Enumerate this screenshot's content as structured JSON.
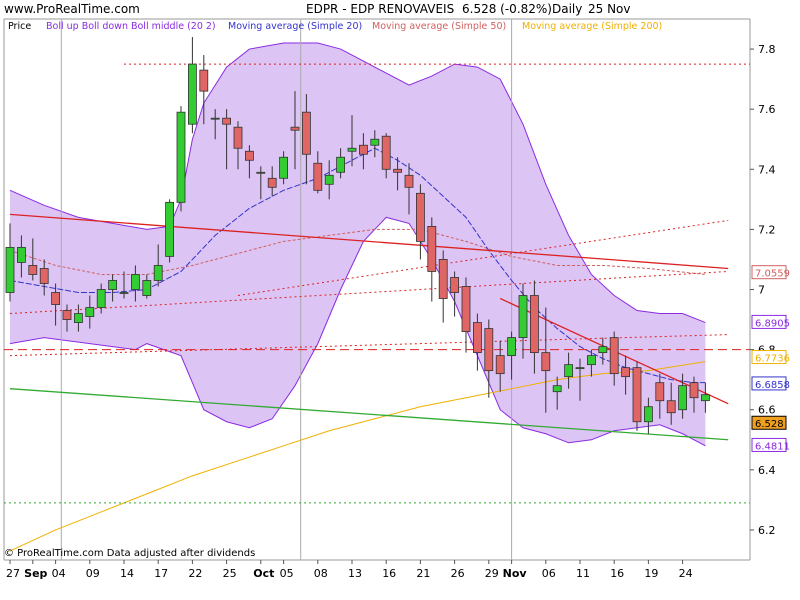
{
  "header": {
    "site": "www.ProRealTime.com",
    "title": "EDPR - EDP RENOVAVEIS",
    "quote": "6.528 (-0.82%)",
    "period": "Daily",
    "date": "25 Nov"
  },
  "footer": {
    "note": "© ProRealTime.com  Data adjusted after dividends"
  },
  "legend": [
    {
      "label": "Price",
      "color": "#000000"
    },
    {
      "label": "Boll up Boll down Boll middle (20 2)",
      "color": "#8a2be2"
    },
    {
      "label": "Moving average (Simple 20)",
      "color": "#3333cc"
    },
    {
      "label": "Moving average (Simple 50)",
      "color": "#d06060"
    },
    {
      "label": "Moving average (Simple 200)",
      "color": "#f0b000"
    }
  ],
  "colors": {
    "up": "#33cc33",
    "down": "#e06666",
    "band_fill": "#dcc4f4",
    "band_line": "#8a2be2",
    "ma20": "#3333cc",
    "ma50": "#d06060",
    "ma200": "#f0b000",
    "trend_red": "#dd2222",
    "trend_green": "#33aa33",
    "price_tag": "#f0a020"
  },
  "chart_data": {
    "type": "candlestick",
    "ylim": [
      6.1,
      7.9
    ],
    "y_ticks": [
      "7.8",
      "7.6",
      "7.4",
      "7.2",
      "7",
      "6.8",
      "6.6",
      "6.4",
      "6.2"
    ],
    "y_tick_values": [
      7.8,
      7.6,
      7.4,
      7.2,
      7.0,
      6.8,
      6.6,
      6.4,
      6.2
    ],
    "x_labels": [
      {
        "label": "27",
        "i": 0,
        "bold": false
      },
      {
        "label": "Sep",
        "i": 2,
        "bold": true
      },
      {
        "label": "04",
        "i": 4,
        "bold": false
      },
      {
        "label": "09",
        "i": 7,
        "bold": false
      },
      {
        "label": "14",
        "i": 10,
        "bold": false
      },
      {
        "label": "17",
        "i": 13,
        "bold": false
      },
      {
        "label": "22",
        "i": 16,
        "bold": false
      },
      {
        "label": "25",
        "i": 19,
        "bold": false
      },
      {
        "label": "Oct",
        "i": 22,
        "bold": true
      },
      {
        "label": "05",
        "i": 24,
        "bold": false
      },
      {
        "label": "08",
        "i": 27,
        "bold": false
      },
      {
        "label": "13",
        "i": 30,
        "bold": false
      },
      {
        "label": "16",
        "i": 33,
        "bold": false
      },
      {
        "label": "21",
        "i": 36,
        "bold": false
      },
      {
        "label": "26",
        "i": 39,
        "bold": false
      },
      {
        "label": "29",
        "i": 42,
        "bold": false
      },
      {
        "label": "Nov",
        "i": 44,
        "bold": true
      },
      {
        "label": "06",
        "i": 47,
        "bold": false
      },
      {
        "label": "11",
        "i": 50,
        "bold": false
      },
      {
        "label": "16",
        "i": 53,
        "bold": false
      },
      {
        "label": "19",
        "i": 56,
        "bold": false
      },
      {
        "label": "24",
        "i": 59,
        "bold": false
      }
    ],
    "month_separators": [
      4.5,
      25.5,
      44.0
    ],
    "candles": [
      {
        "o": 6.99,
        "h": 7.22,
        "l": 6.96,
        "c": 7.14
      },
      {
        "o": 7.09,
        "h": 7.18,
        "l": 7.04,
        "c": 7.14
      },
      {
        "o": 7.08,
        "h": 7.17,
        "l": 7.03,
        "c": 7.05
      },
      {
        "o": 7.07,
        "h": 7.1,
        "l": 6.98,
        "c": 7.02
      },
      {
        "o": 6.99,
        "h": 7.02,
        "l": 6.88,
        "c": 6.95
      },
      {
        "o": 6.93,
        "h": 6.95,
        "l": 6.86,
        "c": 6.9
      },
      {
        "o": 6.89,
        "h": 6.95,
        "l": 6.86,
        "c": 6.92
      },
      {
        "o": 6.91,
        "h": 6.98,
        "l": 6.87,
        "c": 6.94
      },
      {
        "o": 6.94,
        "h": 7.02,
        "l": 6.92,
        "c": 7.0
      },
      {
        "o": 7.0,
        "h": 7.05,
        "l": 6.96,
        "c": 7.03
      },
      {
        "o": 6.99,
        "h": 7.06,
        "l": 6.97,
        "c": 6.99
      },
      {
        "o": 7.0,
        "h": 7.08,
        "l": 6.96,
        "c": 7.05
      },
      {
        "o": 6.98,
        "h": 7.05,
        "l": 6.97,
        "c": 7.03
      },
      {
        "o": 7.03,
        "h": 7.15,
        "l": 7.01,
        "c": 7.08
      },
      {
        "o": 7.11,
        "h": 7.3,
        "l": 7.09,
        "c": 7.29
      },
      {
        "o": 7.29,
        "h": 7.61,
        "l": 7.26,
        "c": 7.59
      },
      {
        "o": 7.55,
        "h": 7.84,
        "l": 7.52,
        "c": 7.75
      },
      {
        "o": 7.73,
        "h": 7.78,
        "l": 7.55,
        "c": 7.66
      },
      {
        "o": 7.57,
        "h": 7.6,
        "l": 7.5,
        "c": 7.57
      },
      {
        "o": 7.57,
        "h": 7.6,
        "l": 7.4,
        "c": 7.55
      },
      {
        "o": 7.54,
        "h": 7.56,
        "l": 7.4,
        "c": 7.47
      },
      {
        "o": 7.46,
        "h": 7.48,
        "l": 7.37,
        "c": 7.43
      },
      {
        "o": 7.39,
        "h": 7.41,
        "l": 7.3,
        "c": 7.39
      },
      {
        "o": 7.37,
        "h": 7.41,
        "l": 7.31,
        "c": 7.34
      },
      {
        "o": 7.37,
        "h": 7.46,
        "l": 7.35,
        "c": 7.44
      },
      {
        "o": 7.54,
        "h": 7.66,
        "l": 7.4,
        "c": 7.53
      },
      {
        "o": 7.59,
        "h": 7.65,
        "l": 7.35,
        "c": 7.45
      },
      {
        "o": 7.42,
        "h": 7.46,
        "l": 7.32,
        "c": 7.33
      },
      {
        "o": 7.35,
        "h": 7.43,
        "l": 7.3,
        "c": 7.38
      },
      {
        "o": 7.39,
        "h": 7.47,
        "l": 7.37,
        "c": 7.44
      },
      {
        "o": 7.46,
        "h": 7.58,
        "l": 7.41,
        "c": 7.47
      },
      {
        "o": 7.48,
        "h": 7.52,
        "l": 7.4,
        "c": 7.45
      },
      {
        "o": 7.48,
        "h": 7.53,
        "l": 7.44,
        "c": 7.5
      },
      {
        "o": 7.51,
        "h": 7.52,
        "l": 7.37,
        "c": 7.4
      },
      {
        "o": 7.4,
        "h": 7.44,
        "l": 7.33,
        "c": 7.39
      },
      {
        "o": 7.38,
        "h": 7.42,
        "l": 7.25,
        "c": 7.34
      },
      {
        "o": 7.32,
        "h": 7.35,
        "l": 7.1,
        "c": 7.16
      },
      {
        "o": 7.21,
        "h": 7.24,
        "l": 6.96,
        "c": 7.06
      },
      {
        "o": 7.1,
        "h": 7.13,
        "l": 6.89,
        "c": 6.97
      },
      {
        "o": 7.04,
        "h": 7.06,
        "l": 6.91,
        "c": 6.99
      },
      {
        "o": 7.01,
        "h": 7.04,
        "l": 6.79,
        "c": 6.86
      },
      {
        "o": 6.89,
        "h": 6.92,
        "l": 6.73,
        "c": 6.79
      },
      {
        "o": 6.87,
        "h": 6.9,
        "l": 6.64,
        "c": 6.73
      },
      {
        "o": 6.78,
        "h": 6.83,
        "l": 6.66,
        "c": 6.72
      },
      {
        "o": 6.78,
        "h": 6.86,
        "l": 6.7,
        "c": 6.84
      },
      {
        "o": 6.84,
        "h": 7.02,
        "l": 6.77,
        "c": 6.98
      },
      {
        "o": 6.98,
        "h": 7.03,
        "l": 6.72,
        "c": 6.79
      },
      {
        "o": 6.79,
        "h": 6.94,
        "l": 6.59,
        "c": 6.73
      },
      {
        "o": 6.66,
        "h": 6.71,
        "l": 6.6,
        "c": 6.68
      },
      {
        "o": 6.71,
        "h": 6.79,
        "l": 6.67,
        "c": 6.75
      },
      {
        "o": 6.74,
        "h": 6.77,
        "l": 6.63,
        "c": 6.74
      },
      {
        "o": 6.75,
        "h": 6.8,
        "l": 6.71,
        "c": 6.78
      },
      {
        "o": 6.79,
        "h": 6.84,
        "l": 6.75,
        "c": 6.81
      },
      {
        "o": 6.84,
        "h": 6.86,
        "l": 6.68,
        "c": 6.72
      },
      {
        "o": 6.74,
        "h": 6.78,
        "l": 6.65,
        "c": 6.71
      },
      {
        "o": 6.74,
        "h": 6.76,
        "l": 6.53,
        "c": 6.56
      },
      {
        "o": 6.56,
        "h": 6.64,
        "l": 6.52,
        "c": 6.61
      },
      {
        "o": 6.69,
        "h": 6.72,
        "l": 6.57,
        "c": 6.63
      },
      {
        "o": 6.63,
        "h": 6.69,
        "l": 6.55,
        "c": 6.59
      },
      {
        "o": 6.6,
        "h": 6.72,
        "l": 6.57,
        "c": 6.68
      },
      {
        "o": 6.69,
        "h": 6.71,
        "l": 6.59,
        "c": 6.64
      },
      {
        "o": 6.63,
        "h": 6.69,
        "l": 6.59,
        "c": 6.65
      }
    ],
    "boll_up": [
      [
        0,
        7.33
      ],
      [
        3,
        7.28
      ],
      [
        6,
        7.24
      ],
      [
        9,
        7.22
      ],
      [
        12,
        7.2
      ],
      [
        14,
        7.21
      ],
      [
        15,
        7.3
      ],
      [
        16,
        7.5
      ],
      [
        17,
        7.62
      ],
      [
        19,
        7.74
      ],
      [
        21,
        7.8
      ],
      [
        24,
        7.82
      ],
      [
        27,
        7.82
      ],
      [
        29,
        7.8
      ],
      [
        31,
        7.76
      ],
      [
        33,
        7.72
      ],
      [
        35,
        7.68
      ],
      [
        37,
        7.71
      ],
      [
        39,
        7.75
      ],
      [
        41,
        7.74
      ],
      [
        43,
        7.7
      ],
      [
        45,
        7.55
      ],
      [
        47,
        7.35
      ],
      [
        49,
        7.18
      ],
      [
        51,
        7.05
      ],
      [
        53,
        6.98
      ],
      [
        55,
        6.93
      ],
      [
        57,
        6.92
      ],
      [
        59,
        6.92
      ],
      [
        61,
        6.89
      ]
    ],
    "boll_down": [
      [
        0,
        6.82
      ],
      [
        3,
        6.84
      ],
      [
        5,
        6.83
      ],
      [
        7,
        6.82
      ],
      [
        9,
        6.81
      ],
      [
        11,
        6.8
      ],
      [
        12,
        6.82
      ],
      [
        15,
        6.78
      ],
      [
        17,
        6.6
      ],
      [
        19,
        6.56
      ],
      [
        21,
        6.54
      ],
      [
        23,
        6.57
      ],
      [
        25,
        6.68
      ],
      [
        27,
        6.82
      ],
      [
        29,
        7.0
      ],
      [
        31,
        7.16
      ],
      [
        33,
        7.24
      ],
      [
        35,
        7.22
      ],
      [
        37,
        7.1
      ],
      [
        39,
        6.96
      ],
      [
        41,
        6.78
      ],
      [
        43,
        6.6
      ],
      [
        45,
        6.54
      ],
      [
        47,
        6.52
      ],
      [
        49,
        6.49
      ],
      [
        51,
        6.5
      ],
      [
        53,
        6.53
      ],
      [
        55,
        6.54
      ],
      [
        57,
        6.55
      ],
      [
        59,
        6.52
      ],
      [
        61,
        6.48
      ]
    ],
    "ma20": [
      [
        0,
        7.03
      ],
      [
        3,
        7.01
      ],
      [
        6,
        6.99
      ],
      [
        9,
        6.99
      ],
      [
        12,
        7.0
      ],
      [
        15,
        7.06
      ],
      [
        18,
        7.18
      ],
      [
        21,
        7.27
      ],
      [
        24,
        7.33
      ],
      [
        27,
        7.37
      ],
      [
        30,
        7.43
      ],
      [
        32,
        7.47
      ],
      [
        34,
        7.43
      ],
      [
        36,
        7.38
      ],
      [
        38,
        7.31
      ],
      [
        40,
        7.24
      ],
      [
        42,
        7.13
      ],
      [
        44,
        7.03
      ],
      [
        46,
        6.94
      ],
      [
        48,
        6.87
      ],
      [
        50,
        6.81
      ],
      [
        52,
        6.77
      ],
      [
        54,
        6.74
      ],
      [
        56,
        6.72
      ],
      [
        58,
        6.7
      ],
      [
        60,
        6.69
      ],
      [
        61,
        6.69
      ]
    ],
    "ma50": [
      [
        0,
        7.13
      ],
      [
        4,
        7.08
      ],
      [
        8,
        7.05
      ],
      [
        12,
        7.05
      ],
      [
        16,
        7.08
      ],
      [
        20,
        7.12
      ],
      [
        24,
        7.16
      ],
      [
        28,
        7.18
      ],
      [
        32,
        7.2
      ],
      [
        36,
        7.2
      ],
      [
        40,
        7.16
      ],
      [
        44,
        7.11
      ],
      [
        48,
        7.08
      ],
      [
        52,
        7.08
      ],
      [
        56,
        7.07
      ],
      [
        61,
        7.05
      ]
    ],
    "ma200": [
      [
        0,
        6.13
      ],
      [
        4,
        6.2
      ],
      [
        8,
        6.26
      ],
      [
        12,
        6.32
      ],
      [
        16,
        6.38
      ],
      [
        20,
        6.43
      ],
      [
        24,
        6.48
      ],
      [
        28,
        6.53
      ],
      [
        32,
        6.57
      ],
      [
        36,
        6.61
      ],
      [
        40,
        6.64
      ],
      [
        44,
        6.67
      ],
      [
        48,
        6.7
      ],
      [
        52,
        6.72
      ],
      [
        56,
        6.73
      ],
      [
        61,
        6.76
      ]
    ],
    "trendlines": [
      {
        "style": "solid",
        "color": "trend_red",
        "from": [
          0,
          7.25
        ],
        "to": [
          63,
          7.07
        ]
      },
      {
        "style": "solid",
        "color": "trend_red",
        "from": [
          43,
          6.97
        ],
        "to": [
          63,
          6.62
        ]
      },
      {
        "style": "solid",
        "color": "trend_green",
        "from": [
          0,
          6.67
        ],
        "to": [
          63,
          6.5
        ]
      },
      {
        "style": "dotted",
        "color": "trend_red",
        "from": [
          0,
          6.92
        ],
        "to": [
          63,
          7.06
        ]
      },
      {
        "style": "dotted",
        "color": "trend_red",
        "from": [
          0,
          6.78
        ],
        "to": [
          63,
          6.85
        ]
      },
      {
        "style": "dotted",
        "color": "trend_red",
        "from": [
          20,
          6.98
        ],
        "to": [
          63,
          7.23
        ]
      }
    ],
    "hlines": [
      {
        "y": 7.75,
        "style": "dotted",
        "color": "trend_red",
        "x_start": 10
      },
      {
        "y": 6.8,
        "style": "dashed",
        "color": "trend_red",
        "x_start": 0
      },
      {
        "y": 6.29,
        "style": "dotted",
        "color": "trend_green",
        "x_start": 0
      }
    ],
    "price_tags": [
      {
        "text": "7.0559",
        "y": 7.0559,
        "bg": "#ffffff",
        "fg": "#d06060"
      },
      {
        "text": "6.8905",
        "y": 6.8905,
        "bg": "#ffffff",
        "fg": "#8a2be2"
      },
      {
        "text": "6.7736",
        "y": 6.7736,
        "bg": "#ffffff",
        "fg": "#f0b000"
      },
      {
        "text": "6.6858",
        "y": 6.6858,
        "bg": "#ffffff",
        "fg": "#3333cc"
      },
      {
        "text": "6.528",
        "y": 6.555,
        "bg": "#f0a020",
        "fg": "#000000"
      },
      {
        "text": "6.4811",
        "y": 6.4811,
        "bg": "#ffffff",
        "fg": "#8a2be2"
      }
    ]
  }
}
